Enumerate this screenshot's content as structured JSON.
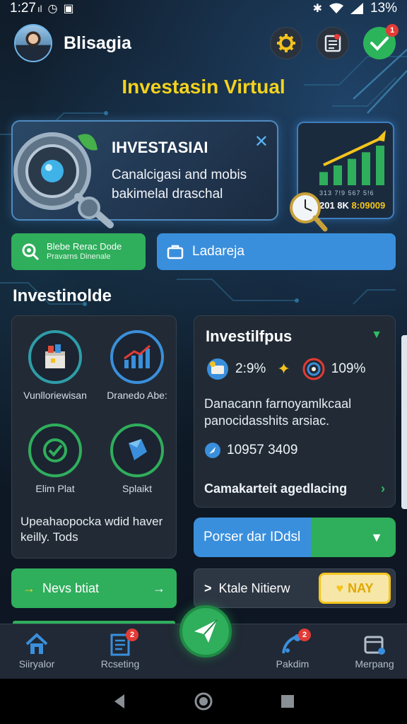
{
  "status_bar": {
    "time": "1:27",
    "signal_suffix": "ıl",
    "battery": "13%"
  },
  "header": {
    "brand": "Blisagia",
    "notif_badge": "1"
  },
  "app_title": "Investasin Virtual",
  "hero": {
    "title": "IHVESTASIAI",
    "close": "✕",
    "body": "Canalcigasi and mobis bakimelal draschal"
  },
  "mini_chart": {
    "tick_labels": "313 7!9 567 5!6",
    "footer_prefix": "201 8K",
    "footer_value": "8:09009",
    "values": [
      2,
      3,
      4,
      5,
      6
    ]
  },
  "actions": {
    "green_line1": "Blebe Rerac Dode",
    "green_line2": "Pravarns Dinenale",
    "blue_label": "Ladareja"
  },
  "section_title": "Investinolde",
  "left_panel": {
    "tiles": [
      {
        "label": "Vunlloriewisan"
      },
      {
        "label": "Dranedo Abe:"
      },
      {
        "label": "Elim Plat"
      },
      {
        "label": "Splaikt"
      }
    ],
    "description": "Upeahaopocka wdid haver keilly. Tods"
  },
  "right_panel": {
    "title": "Investilfpus",
    "stat1": "2:9%",
    "stat2": "109%",
    "description": "Danacann farnoyamlkcaal panocidasshits arsiac.",
    "value": "10957 3409",
    "link": "Camakarteit agedlacing"
  },
  "promo": {
    "label": "Porser dar IDdsl"
  },
  "bottom_buttons": {
    "left_label": "Nevs btiat",
    "right_label": "Ktale Nitierw",
    "pill_label": "NAY"
  },
  "nav": {
    "items": [
      {
        "label": "Siiryalor",
        "badge": ""
      },
      {
        "label": "Rcseting",
        "badge": "2"
      },
      {
        "label": "Pakdim",
        "badge": "2"
      },
      {
        "label": "Merpang",
        "badge": ""
      }
    ]
  },
  "colors": {
    "accent_green": "#2fae5c",
    "accent_blue": "#3a8fdc",
    "title_yellow": "#f4d21c",
    "badge_red": "#e33b35"
  }
}
